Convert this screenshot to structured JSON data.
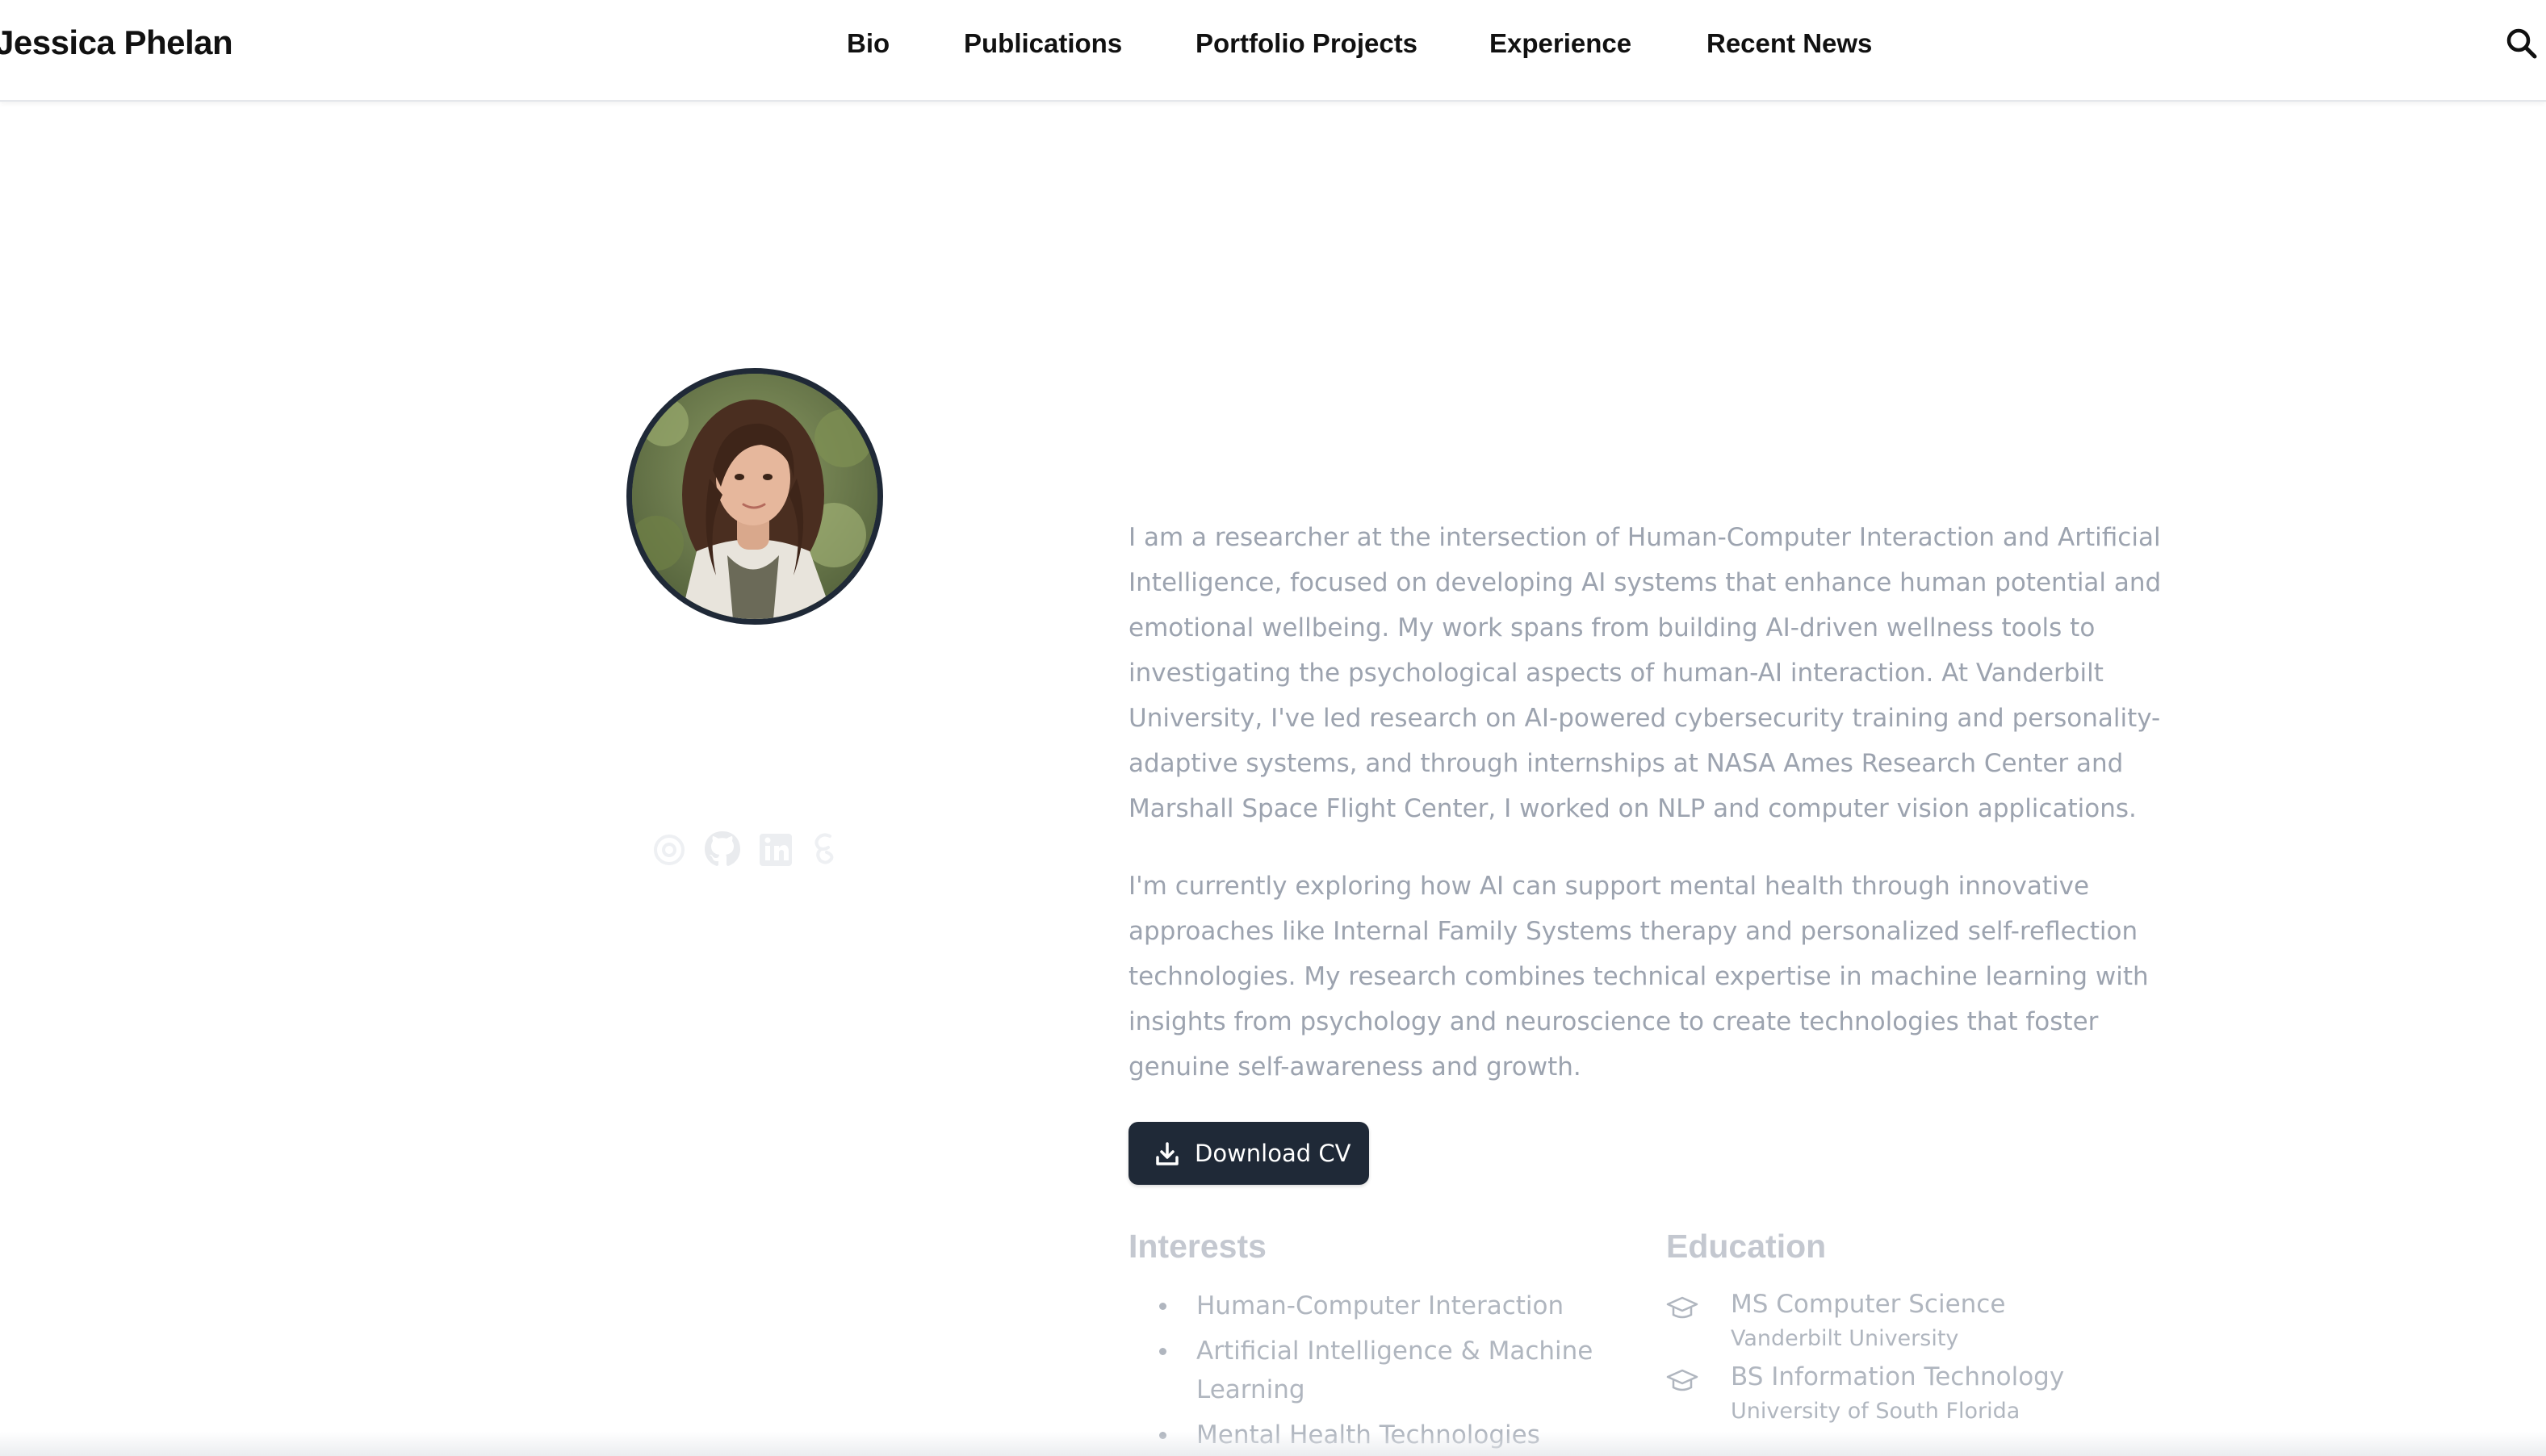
{
  "header": {
    "site_title": "Jessica Phelan",
    "nav": [
      {
        "label": "Bio"
      },
      {
        "label": "Publications"
      },
      {
        "label": "Portfolio Projects"
      },
      {
        "label": "Experience"
      },
      {
        "label": "Recent News"
      }
    ],
    "search_icon": "search-icon"
  },
  "profile": {
    "avatar_icon": "profile-photo",
    "socials": [
      {
        "icon": "email-icon"
      },
      {
        "icon": "github-icon"
      },
      {
        "icon": "linkedin-icon"
      },
      {
        "icon": "google-scholar-icon"
      }
    ]
  },
  "bio": {
    "paragraph_1": "I am a researcher at the intersection of Human-Computer Interaction and Artificial Intelligence, focused on developing AI systems that enhance human potential and emotional wellbeing. My work spans from building AI-driven wellness tools to investigating the psychological aspects of human-AI interaction. At Vanderbilt University, I've led research on AI-powered cybersecurity training and personality-adaptive systems, and through internships at NASA Ames Research Center and Marshall Space Flight Center, I worked on NLP and computer vision applications.",
    "paragraph_2": "I'm currently exploring how AI can support mental health through innovative approaches like Internal Family Systems therapy and personalized self-reflection technologies. My research combines technical expertise in machine learning with insights from psychology and neuroscience to create technologies that foster genuine self-awareness and growth.",
    "download_cv_label": "Download CV",
    "download_icon": "download-icon"
  },
  "interests": {
    "title": "Interests",
    "items": [
      "Human-Computer Interaction",
      "Artificial Intelligence & Machine Learning",
      "Mental Health Technologies"
    ]
  },
  "education": {
    "title": "Education",
    "items": [
      {
        "degree": "MS Computer Science",
        "school": "Vanderbilt University",
        "icon": "graduation-cap-icon"
      },
      {
        "degree": "BS Information Technology",
        "school": "University of South Florida",
        "icon": "graduation-cap-icon"
      }
    ]
  },
  "colors": {
    "primary_dark": "#1f2937",
    "muted_text": "#9ca3af",
    "heading_muted": "#c4c8d0"
  }
}
